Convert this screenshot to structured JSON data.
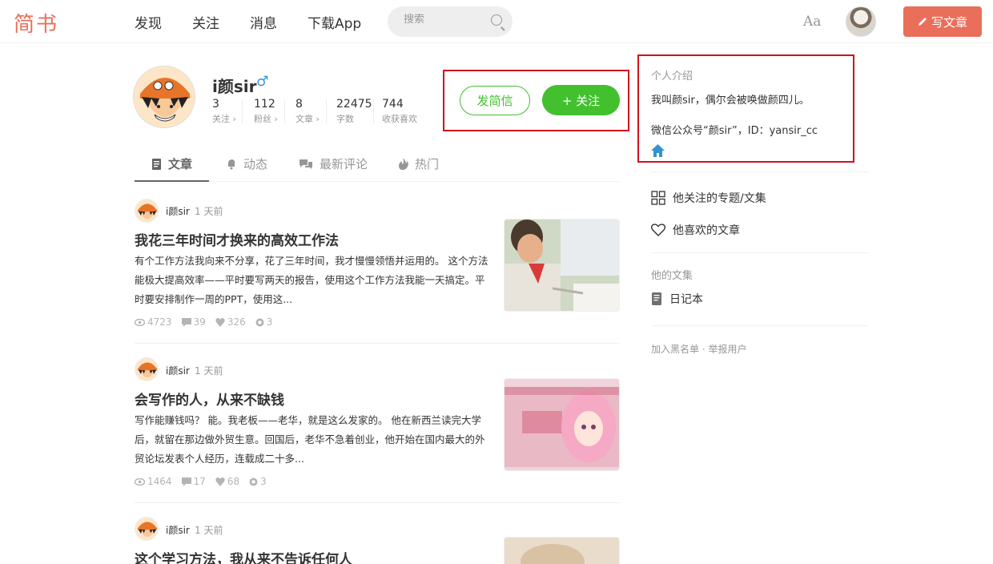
{
  "brand": {
    "logo": "简书",
    "accent": "#ea6f5a",
    "green": "#42c02e",
    "highlight_box": "#d0121b"
  },
  "nav": {
    "items": [
      "发现",
      "关注",
      "消息",
      "下载App"
    ],
    "search_placeholder": "搜索",
    "font_toggle": "Aa",
    "write_label": "写文章"
  },
  "profile": {
    "name": "i颜sir",
    "gender_symbol": "♂",
    "stats": [
      {
        "num": "3",
        "label": "关注 ›"
      },
      {
        "num": "112",
        "label": "粉丝 ›"
      },
      {
        "num": "8",
        "label": "文章 ›"
      },
      {
        "num": "22475",
        "label": "字数"
      },
      {
        "num": "744",
        "label": "收获喜欢"
      }
    ],
    "message_label": "发简信",
    "follow_label": "+ 关注"
  },
  "tabs": [
    {
      "label": "文章",
      "icon": "document-icon",
      "active": true
    },
    {
      "label": "动态",
      "icon": "bell-icon"
    },
    {
      "label": "最新评论",
      "icon": "comments-icon"
    },
    {
      "label": "热门",
      "icon": "fire-icon"
    }
  ],
  "articles": [
    {
      "author": "i颜sir",
      "time": "1 天前",
      "title": "我花三年时间才换来的高效工作法",
      "abstract": "有个工作方法我向来不分享，花了三年时间，我才慢慢领悟并运用的。 这个方法能极大提高效率——平时要写两天的报告，使用这个工作方法我能一天搞定。平时要安排制作一周的PPT，使用这...",
      "views": "4723",
      "comments": "39",
      "likes": "326",
      "rewards": "3"
    },
    {
      "author": "i颜sir",
      "time": "1 天前",
      "title": "会写作的人，从来不缺钱",
      "abstract": "写作能赚钱吗？ 能。我老板——老华，就是这么发家的。 他在新西兰读完大学后，就留在那边做外贸生意。回国后，老华不急着创业，他开始在国内最大的外贸论坛发表个人经历，连载成二十多...",
      "views": "1464",
      "comments": "17",
      "likes": "68",
      "rewards": "3"
    },
    {
      "author": "i颜sir",
      "time": "1 天前",
      "title": "这个学习方法，我从来不告诉任何人"
    }
  ],
  "sidebar": {
    "intro_title": "个人介绍",
    "intro_lines": [
      "我叫颜sir，偶尔会被唤做颜四儿。",
      "微信公众号“颜sir”，ID：yansir_cc"
    ],
    "links": [
      "他关注的专题/文集",
      "他喜欢的文章"
    ],
    "collections_title": "他的文集",
    "collection": "日记本",
    "report": "加入黑名单 · 举报用户"
  }
}
